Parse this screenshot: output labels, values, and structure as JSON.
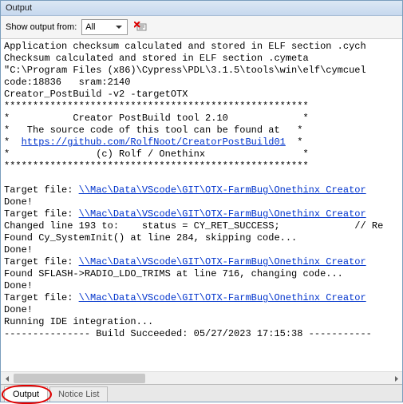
{
  "window": {
    "title": "Output"
  },
  "toolbar": {
    "label": "Show output from:",
    "dropdown_value": "All"
  },
  "logs": {
    "lines": [
      {
        "t": "Application checksum calculated and stored in ELF section .cych"
      },
      {
        "t": "Checksum calculated and stored in ELF section .cymeta"
      },
      {
        "t": "\"C:\\Program Files (x86)\\Cypress\\PDL\\3.1.5\\tools\\win\\elf\\cymcuel"
      },
      {
        "t": "code:18836   sram:2140"
      },
      {
        "t": "Creator_PostBuild -v2 -targetOTX"
      },
      {
        "t": "*****************************************************"
      },
      {
        "t": "*           Creator PostBuild tool 2.10             *"
      },
      {
        "pre": "*   The source code of this tool can be found at   *"
      },
      {
        "pre": "*  ",
        "link": "https://github.com/RolfNoot/CreatorPostBuild01",
        "post": "  *"
      },
      {
        "t": "*               (c) Rolf / Onethinx                 *"
      },
      {
        "t": "*****************************************************"
      },
      {
        "t": ""
      },
      {
        "pre": "Target file: ",
        "link": "\\\\Mac\\Data\\VScode\\GIT\\OTX-FarmBug\\Onethinx Creator"
      },
      {
        "t": "Done!"
      },
      {
        "pre": "Target file: ",
        "link": "\\\\Mac\\Data\\VScode\\GIT\\OTX-FarmBug\\Onethinx Creator"
      },
      {
        "t": "Changed line 193 to:    status = CY_RET_SUCCESS;             // Re"
      },
      {
        "t": "Found Cy_SystemInit() at line 284, skipping code..."
      },
      {
        "t": "Done!"
      },
      {
        "pre": "Target file: ",
        "link": "\\\\Mac\\Data\\VScode\\GIT\\OTX-FarmBug\\Onethinx Creator"
      },
      {
        "t": "Found SFLASH->RADIO_LDO_TRIMS at line 716, changing code..."
      },
      {
        "t": "Done!"
      },
      {
        "pre": "Target file: ",
        "link": "\\\\Mac\\Data\\VScode\\GIT\\OTX-FarmBug\\Onethinx Creator"
      },
      {
        "t": "Done!"
      },
      {
        "t": "Running IDE integration..."
      },
      {
        "t": "--------------- Build Succeeded: 05/27/2023 17:15:38 -----------"
      },
      {
        "t": ""
      }
    ]
  },
  "tabs": {
    "items": [
      {
        "label": "Output",
        "active": true,
        "highlighted": true
      },
      {
        "label": "Notice List",
        "active": false,
        "highlighted": false
      }
    ]
  }
}
